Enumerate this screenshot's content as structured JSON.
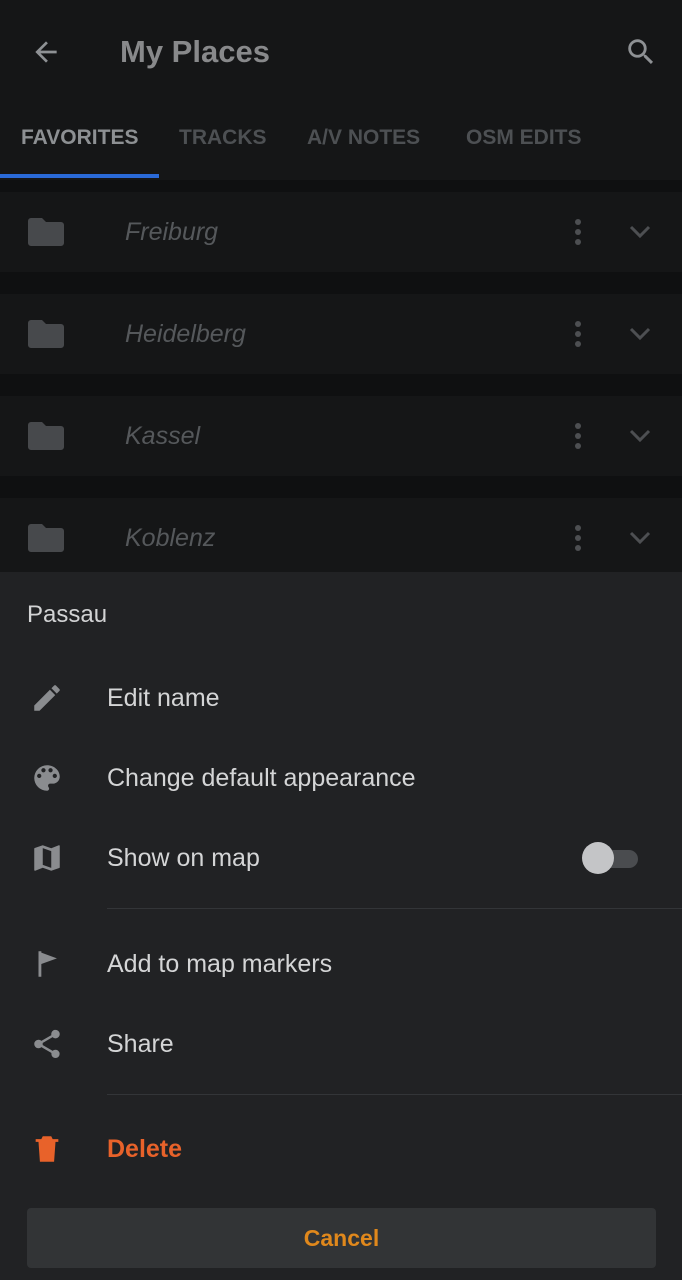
{
  "appbar": {
    "title": "My Places",
    "back_icon": "arrow-back-icon",
    "search_icon": "search-icon"
  },
  "tabs": [
    {
      "label": "FAVORITES",
      "active": true
    },
    {
      "label": "TRACKS",
      "active": false
    },
    {
      "label": "A/V NOTES",
      "active": false
    },
    {
      "label": "OSM EDITS",
      "active": false
    }
  ],
  "favorites": [
    {
      "name": "Freiburg"
    },
    {
      "name": "Heidelberg"
    },
    {
      "name": "Kassel"
    },
    {
      "name": "Koblenz"
    }
  ],
  "sheet": {
    "title": "Passau",
    "items": [
      {
        "label": "Edit name",
        "icon": "pencil-icon"
      },
      {
        "label": "Change default appearance",
        "icon": "palette-icon"
      },
      {
        "label": "Show on map",
        "icon": "map-icon",
        "toggle": false
      },
      {
        "label": "Add to map markers",
        "icon": "flag-icon"
      },
      {
        "label": "Share",
        "icon": "share-icon"
      },
      {
        "label": "Delete",
        "icon": "trash-icon"
      }
    ],
    "cancel_label": "Cancel"
  },
  "colors": {
    "accent": "#2a6ad8",
    "danger": "#e8622a",
    "cancel_text": "#e0881c",
    "sheet_bg": "#212224"
  }
}
